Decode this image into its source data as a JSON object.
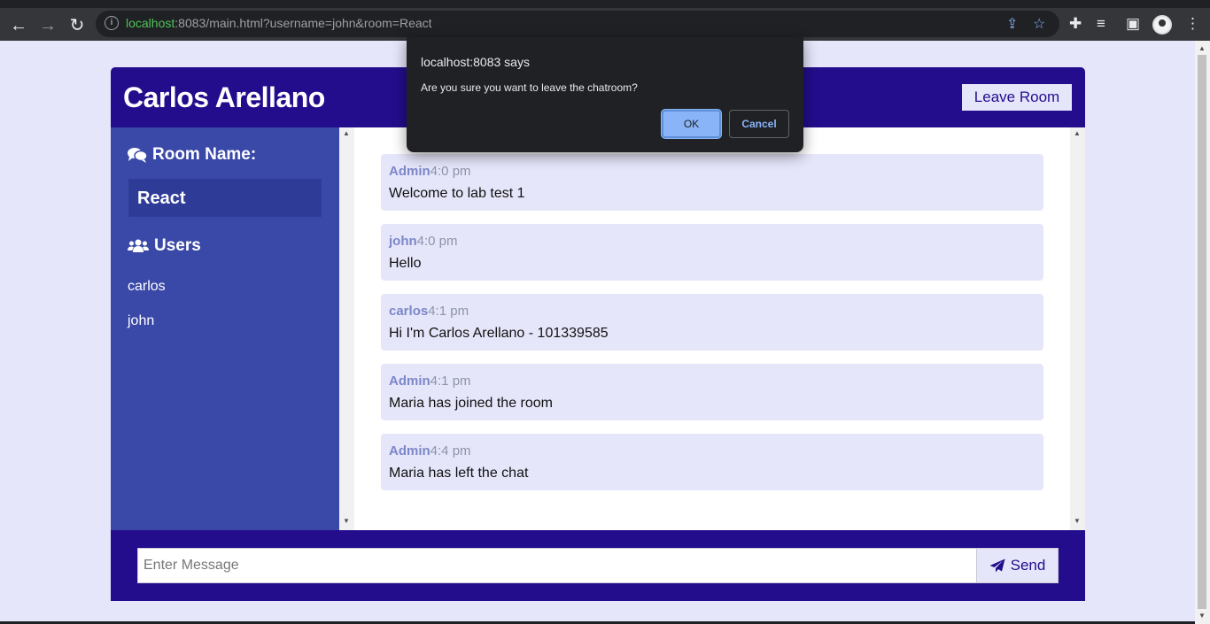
{
  "browser": {
    "url_host": "localhost",
    "url_rest": ":8083/main.html?username=john&room=React"
  },
  "header": {
    "title": "Carlos Arellano",
    "leave_button": "Leave Room"
  },
  "sidebar": {
    "room_heading": "Room Name:",
    "room_name": "React",
    "users_heading": "Users",
    "users": [
      "carlos",
      "john"
    ]
  },
  "messages": [
    {
      "user": "Admin",
      "time": "4:0 pm",
      "text": "Welcome to lab test 1"
    },
    {
      "user": "john",
      "time": "4:0 pm",
      "text": "Hello"
    },
    {
      "user": "carlos",
      "time": "4:1 pm",
      "text": "Hi I'm Carlos Arellano - 101339585"
    },
    {
      "user": "Admin",
      "time": "4:1 pm",
      "text": "Maria has joined the room"
    },
    {
      "user": "Admin",
      "time": "4:4 pm",
      "text": "Maria has left the chat"
    }
  ],
  "form": {
    "placeholder": "Enter Message",
    "send_label": "Send"
  },
  "dialog": {
    "title": "localhost:8083 says",
    "message": "Are you sure you want to leave the chatroom?",
    "ok_label": "OK",
    "cancel_label": "Cancel"
  },
  "colors": {
    "primary": "#230d8c",
    "sidebar": "#3a49a8",
    "background": "#e6e6fb"
  }
}
